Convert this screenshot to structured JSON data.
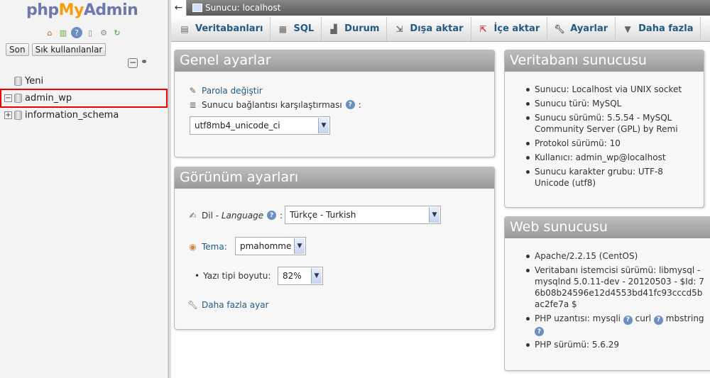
{
  "navigation": {
    "logo": {
      "php": "php",
      "my": "My",
      "admin": "Admin"
    },
    "buttons": {
      "recent": "Son",
      "favorites": "Sık kullanılanlar"
    },
    "tree": [
      {
        "label": "Yeni"
      },
      {
        "label": "admin_wp"
      },
      {
        "label": "information_schema"
      }
    ]
  },
  "topbar": {
    "server": "Sunucu: localhost"
  },
  "tabs": [
    {
      "label": "Veritabanları",
      "icon": "database-icon"
    },
    {
      "label": "SQL",
      "icon": "sql-icon"
    },
    {
      "label": "Durum",
      "icon": "status-chart-icon"
    },
    {
      "label": "Dışa aktar",
      "icon": "export-icon"
    },
    {
      "label": "İçe aktar",
      "icon": "import-icon"
    },
    {
      "label": "Ayarlar",
      "icon": "wrench-icon"
    },
    {
      "label": "Daha fazla",
      "icon": "triangle-down-icon"
    }
  ],
  "general": {
    "title": "Genel ayarlar",
    "change_password": "Parola değiştir",
    "collation_label": "Sunucu bağlantısı karşılaştırması",
    "collation_value": "utf8mb4_unicode_ci"
  },
  "appearance": {
    "title": "Görünüm ayarları",
    "language_label": "Dil - ",
    "language_italic": "Language",
    "language_value": "Türkçe - Turkish",
    "theme_label": "Tema:",
    "theme_value": "pmahomme",
    "font_label": "Yazı tipi boyutu:",
    "font_value": "82%",
    "more_settings": "Daha fazla ayar"
  },
  "db_server": {
    "title": "Veritabanı sunucusu",
    "items": [
      "Sunucu: Localhost via UNIX socket",
      "Sunucu türü: MySQL",
      "Sunucu sürümü: 5.5.54 - MySQL Community Server (GPL) by Remi",
      "Protokol sürümü: 10",
      "Kullanıcı: admin_wp@localhost",
      "Sunucu karakter grubu: UTF-8 Unicode (utf8)"
    ]
  },
  "web_server": {
    "title": "Web sunucusu",
    "apache": "Apache/2.2.15 (CentOS)",
    "client": "Veritabanı istemcisi sürümü: libmysql - mysqlnd 5.0.11-dev - 20120503 - $Id: 76b08b24596e12d4553bd41fc93cccd5bac2fe7a $",
    "php_ext_label": "PHP uzantısı: mysqli",
    "php_ext_curl": "curl",
    "php_ext_mbstring": "mbstring",
    "php_version": "PHP sürümü: 5.6.29"
  },
  "colors": {
    "accent": "#235a81",
    "panel_header": "#a8a8a8",
    "highlight": "#e00000"
  }
}
